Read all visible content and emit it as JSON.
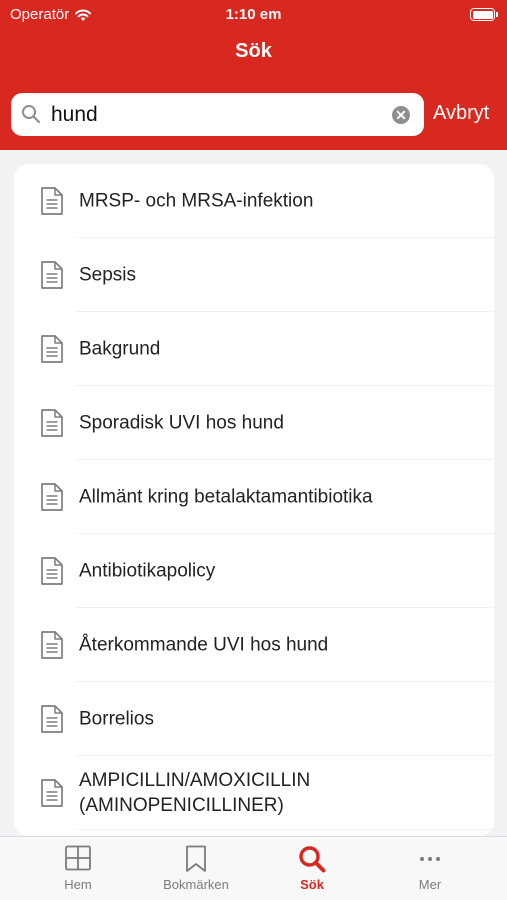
{
  "status": {
    "carrier": "Operatör",
    "time": "1:10 em"
  },
  "nav": {
    "title": "Sök"
  },
  "search": {
    "value": "hund",
    "cancel_label": "Avbryt"
  },
  "results": [
    {
      "label": "MRSP- och MRSA-infektion"
    },
    {
      "label": "Sepsis"
    },
    {
      "label": "Bakgrund"
    },
    {
      "label": "Sporadisk UVI hos hund"
    },
    {
      "label": "Allmänt kring betalaktamantibiotika"
    },
    {
      "label": "Antibiotikapolicy"
    },
    {
      "label": "Återkommande UVI hos hund"
    },
    {
      "label": "Borrelios"
    },
    {
      "label": "AMPICILLIN/AMOXICILLIN (AMINOPENICILLINER)"
    }
  ],
  "tabs": [
    {
      "label": "Hem",
      "icon": "grid-icon"
    },
    {
      "label": "Bokmärken",
      "icon": "bookmark-icon"
    },
    {
      "label": "Sök",
      "icon": "search-icon",
      "active": true
    },
    {
      "label": "Mer",
      "icon": "more-icon"
    }
  ],
  "colors": {
    "accent": "#d8281f",
    "tab_inactive": "#7b7b7b"
  }
}
